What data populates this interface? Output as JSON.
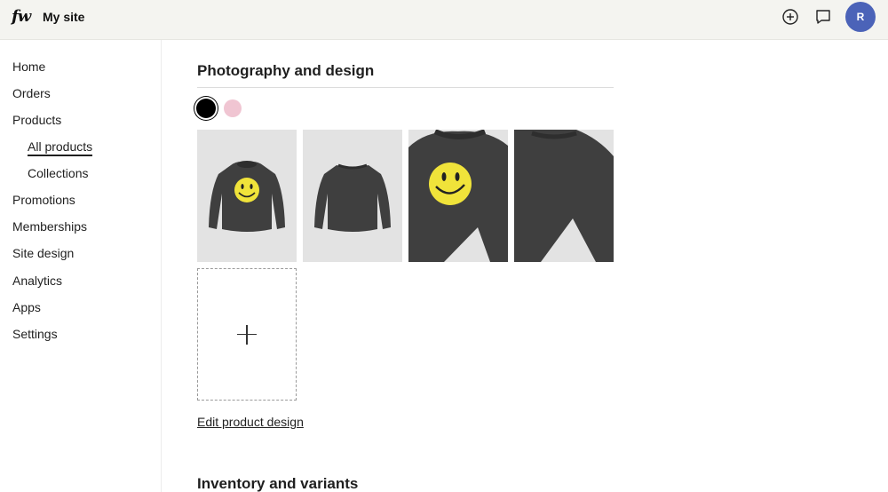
{
  "header": {
    "logo": "fw",
    "site_name": "My site",
    "avatar_initial": "R",
    "avatar_color": "#4b63b8"
  },
  "sidebar": {
    "items": [
      {
        "label": "Home"
      },
      {
        "label": "Orders"
      },
      {
        "label": "Products"
      },
      {
        "label": "All products",
        "active": true
      },
      {
        "label": "Collections"
      },
      {
        "label": "Promotions"
      },
      {
        "label": "Memberships"
      },
      {
        "label": "Site design"
      },
      {
        "label": "Analytics"
      },
      {
        "label": "Apps"
      },
      {
        "label": "Settings"
      }
    ]
  },
  "main": {
    "photography_title": "Photography and design",
    "color_swatches": [
      {
        "name": "black",
        "color": "#000000",
        "selected": true
      },
      {
        "name": "pink",
        "color": "#f0c5d2",
        "selected": false
      }
    ],
    "images": [
      {
        "name": "sweatshirt-front-smiley"
      },
      {
        "name": "sweatshirt-back"
      },
      {
        "name": "sweatshirt-front-closeup"
      },
      {
        "name": "sweatshirt-back-closeup"
      }
    ],
    "edit_design_link": "Edit product design",
    "inventory_title": "Inventory and variants"
  }
}
